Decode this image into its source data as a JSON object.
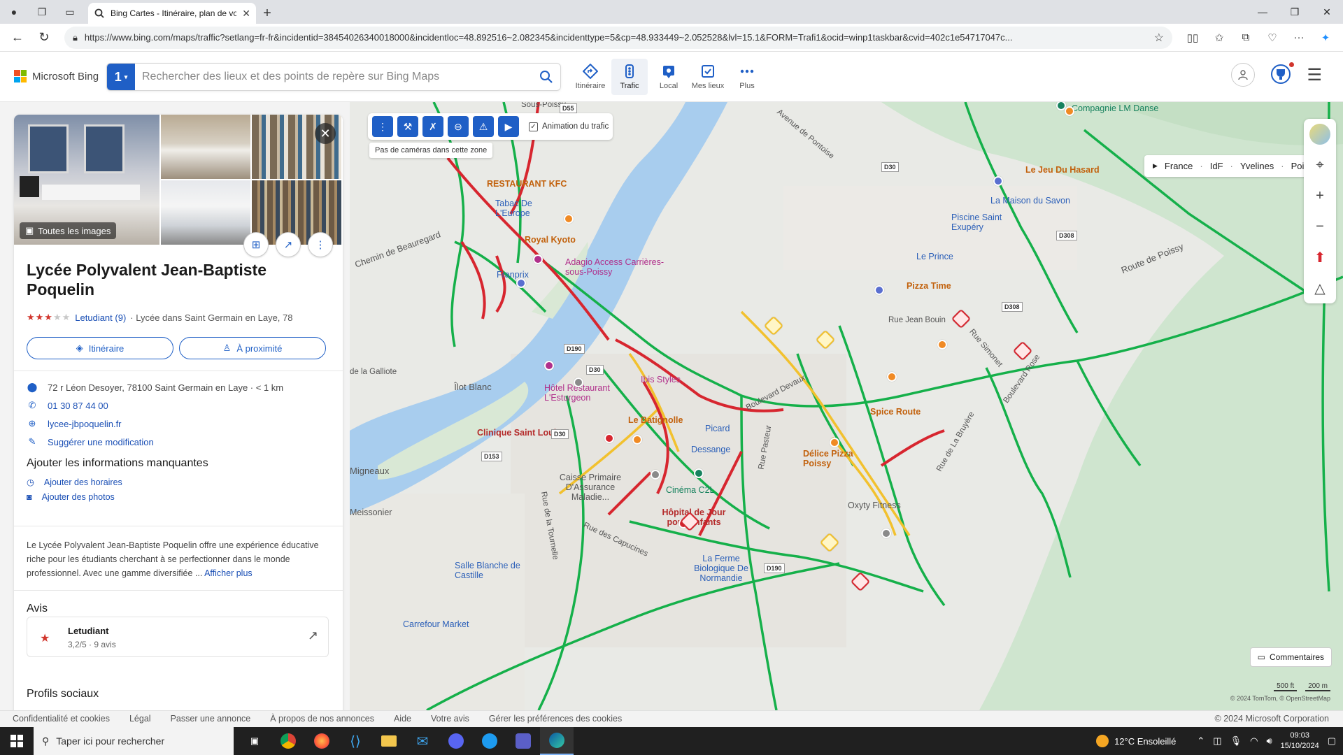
{
  "browser": {
    "tab_title": "Bing Cartes - Itinéraire, plan de vo",
    "url": "https://www.bing.com/maps/traffic?setlang=fr-fr&incidentid=38454026340018000&incidentloc=48.892516~2.082345&incidenttype=5&cp=48.933449~2.052528&lvl=15.1&FORM=Trafi1&ocid=winp1taskbar&cvid=402c1e54717047c..."
  },
  "header": {
    "brand": "Microsoft Bing",
    "search_badge": "1",
    "search_placeholder": "Rechercher des lieux et des points de repère sur Bing Maps",
    "modes": [
      {
        "label": "Itinéraire",
        "icon": "directions-icon"
      },
      {
        "label": "Trafic",
        "icon": "traffic-light-icon",
        "active": true
      },
      {
        "label": "Local",
        "icon": "local-icon"
      },
      {
        "label": "Mes lieux",
        "icon": "saved-places-icon"
      },
      {
        "label": "Plus",
        "icon": "more-icon"
      }
    ]
  },
  "place": {
    "all_images": "Toutes les images",
    "name": "Lycée Polyvalent Jean-Baptiste Poquelin",
    "rating_stars": 3,
    "rating_source": "Letudiant (9)",
    "category": "· Lycée dans Saint Germain en Laye, 78",
    "btn_route": "Itinéraire",
    "btn_nearby": "À proximité",
    "address": "72 r Léon Desoyer, 78100 Saint Germain en Laye · < 1 km",
    "phone": "01 30 87 44 00",
    "website": "lycee-jbpoquelin.fr",
    "suggest": "Suggérer une modification",
    "add_info_title": "Ajouter les informations manquantes",
    "add_hours": "Ajouter des horaires",
    "add_photos": "Ajouter des photos",
    "description": "Le Lycée Polyvalent Jean-Baptiste Poquelin offre une expérience éducative riche pour les étudiants cherchant à se perfectionner dans le monde professionnel. Avec une gamme diversifiée ...",
    "more": "Afficher plus",
    "reviews_title": "Avis",
    "review_source": "Letudiant",
    "review_score": "3,2/5 · 9 avis",
    "social_title": "Profils sociaux"
  },
  "map": {
    "traffic_toggle": "Animation du trafic",
    "tooltip": "Pas de caméras dans cette zone",
    "breadcrumb": [
      "France",
      "IdF",
      "Yvelines",
      "Poissy"
    ],
    "feedback": "Commentaires",
    "scale_ft": "500 ft",
    "scale_m": "200 m",
    "attribution": "© 2024 TomTom, © OpenStreetMap",
    "labels": {
      "sous_poissy": "Sous-Poissy",
      "restaurant_kfc": "RESTAURANT KFC",
      "tabac": "Tabac De L'Europe",
      "royal_kyoto": "Royal Kyoto",
      "adagio": "Adagio Access Carrières-sous-Poissy",
      "franprix": "Franprix",
      "hotel": "Hôtel Restaurant L'Esturgeon",
      "ibis": "Ibis Styles",
      "clinique": "Clinique Saint Louis",
      "batignolle": "Le Batignolle",
      "picard": "Picard",
      "dessange": "Dessange",
      "caisse": "Caisse Primaire D'Assurance Maladie...",
      "cinema": "Cinéma C2L",
      "hopital": "Hôpital de Jour pour Enfants",
      "ferme": "La Ferme Biologique De Normandie",
      "salle": "Salle Blanche de Castille",
      "carrefour": "Carrefour Market",
      "oxyty": "Oxyty Fitness",
      "delice": "Délice Pizza Poissy",
      "spice": "Spice Route",
      "pizza_time": "Pizza Time",
      "le_prince": "Le Prince",
      "piscine": "Piscine Saint Exupéry",
      "maison_savon": "La Maison du Savon",
      "jeu_hasard": "Le Jeu Du Hasard",
      "compagnie": "Compagnie LM Danse",
      "ilot_blanc": "Îlot Blanc",
      "galliote": "de la Galliote",
      "migneaux": "Migneaux",
      "meissonier": "Meissonier",
      "rue_jean_bouin": "Rue Jean Bouin",
      "route_poissy": "Route de Poissy",
      "bd_devaux": "Boulevard Devaux",
      "bd_rose": "Boulevard Rose",
      "rue_simonet": "Rue Simonet",
      "rue_labruyere": "Rue de La Bruyère",
      "rue_capucines": "Rue des Capucines",
      "rue_tournelle": "Rue de la Tournelle",
      "rue_pasteur": "Rue Pasteur",
      "ch_beauregard": "Chemin de Beauregard",
      "av_pontoise": "Avenue de Pontoise",
      "d30": "D30",
      "d308": "D308",
      "d190": "D190",
      "d153": "D153",
      "d55": "D55"
    }
  },
  "footer": {
    "links": [
      "Confidentialité et cookies",
      "Légal",
      "Passer une annonce",
      "À propos de nos annonces",
      "Aide",
      "Votre avis",
      "Gérer les préférences des cookies"
    ],
    "copyright": "© 2024 Microsoft Corporation"
  },
  "taskbar": {
    "search": "Taper ici pour rechercher",
    "weather": "12°C  Ensoleillé",
    "time": "09:03",
    "date": "15/10/2024"
  }
}
